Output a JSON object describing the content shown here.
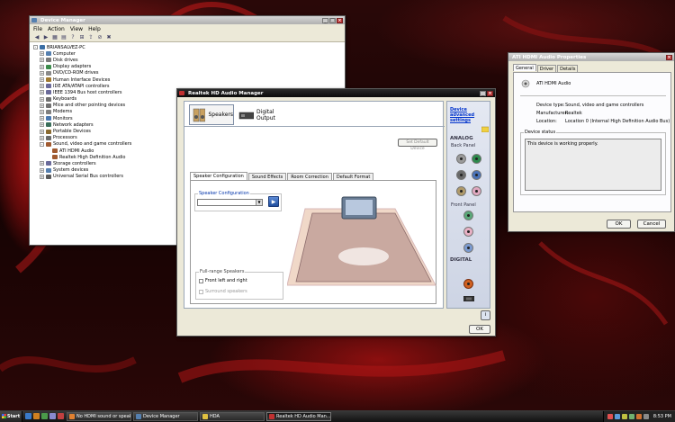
{
  "device_manager": {
    "title": "Device Manager",
    "menu": [
      "File",
      "Action",
      "View",
      "Help"
    ],
    "tree": [
      {
        "label": "BRIANSALVEZ-PC",
        "level": 0,
        "exp": "-",
        "color": "#3a6ea5"
      },
      {
        "label": "Computer",
        "level": 1,
        "exp": "+",
        "color": "#5580b0"
      },
      {
        "label": "Disk drives",
        "level": 1,
        "exp": "+",
        "color": "#7a7a7a"
      },
      {
        "label": "Display adapters",
        "level": 1,
        "exp": "+",
        "color": "#3c8c4c"
      },
      {
        "label": "DVD/CD-ROM drives",
        "level": 1,
        "exp": "+",
        "color": "#8a8a8a"
      },
      {
        "label": "Human Interface Devices",
        "level": 1,
        "exp": "+",
        "color": "#a07a30"
      },
      {
        "label": "IDE ATA/ATAPI controllers",
        "level": 1,
        "exp": "+",
        "color": "#6a6a9a"
      },
      {
        "label": "IEEE 1394 Bus host controllers",
        "level": 1,
        "exp": "+",
        "color": "#6a6a9a"
      },
      {
        "label": "Keyboards",
        "level": 1,
        "exp": "+",
        "color": "#707070"
      },
      {
        "label": "Mice and other pointing devices",
        "level": 1,
        "exp": "+",
        "color": "#707070"
      },
      {
        "label": "Modems",
        "level": 1,
        "exp": "+",
        "color": "#808080"
      },
      {
        "label": "Monitors",
        "level": 1,
        "exp": "+",
        "color": "#4a78b0"
      },
      {
        "label": "Network adapters",
        "level": 1,
        "exp": "+",
        "color": "#3a6e5a"
      },
      {
        "label": "Portable Devices",
        "level": 1,
        "exp": "+",
        "color": "#8a6a30"
      },
      {
        "label": "Processors",
        "level": 1,
        "exp": "+",
        "color": "#6a6a6a"
      },
      {
        "label": "Sound, video and game controllers",
        "level": 1,
        "exp": "-",
        "color": "#a05a30"
      },
      {
        "label": "ATI HDMI Audio",
        "level": 2,
        "exp": "",
        "color": "#a05a30"
      },
      {
        "label": "Realtek High Definition Audio",
        "level": 2,
        "exp": "",
        "color": "#a05a30"
      },
      {
        "label": "Storage controllers",
        "level": 1,
        "exp": "+",
        "color": "#6a6a9a"
      },
      {
        "label": "System devices",
        "level": 1,
        "exp": "+",
        "color": "#5580b0"
      },
      {
        "label": "Universal Serial Bus controllers",
        "level": 1,
        "exp": "+",
        "color": "#5a5a5a"
      }
    ]
  },
  "realtek": {
    "title": "Realtek HD Audio Manager",
    "tab_speakers": "Speakers",
    "tab_digital": "Digital Output",
    "set_default": "Set Default Device",
    "subtabs": [
      "Speaker Configuration",
      "Sound Effects",
      "Room Correction",
      "Default Format"
    ],
    "config_label": "Speaker Configuration",
    "config_value": "",
    "fullrange_label": "Full-range Speakers",
    "front_lr": "Front left and right",
    "surround": "Surround speakers",
    "advanced_link": "Device advanced settings",
    "analog": "ANALOG",
    "back_panel": "Back Panel",
    "front_panel": "Front Panel",
    "digital": "DIGITAL",
    "ok": "OK",
    "info_icon": "i"
  },
  "ati": {
    "title": "ATI HDMI Audio Properties",
    "tabs": [
      "General",
      "Driver",
      "Details"
    ],
    "device_name": "ATI HDMI Audio",
    "device_type_label": "Device type:",
    "device_type": "Sound, video and game controllers",
    "manufacturer_label": "Manufacturer:",
    "manufacturer": "Realtek",
    "location_label": "Location:",
    "location": "Location 0 (Internal High Definition Audio Bus)",
    "status_label": "Device status",
    "status_text": "This device is working properly.",
    "ok": "OK",
    "cancel": "Cancel"
  },
  "taskbar": {
    "start": "Start",
    "tasks": [
      {
        "label": "No HDMI sound or speak...",
        "icon": "#e08030"
      },
      {
        "label": "Device Manager",
        "icon": "#5580b0"
      },
      {
        "label": "HDA",
        "icon": "#e0c040"
      },
      {
        "label": "Realtek HD Audio Man...",
        "icon": "#c03030"
      }
    ],
    "clock": "8:53 PM"
  }
}
